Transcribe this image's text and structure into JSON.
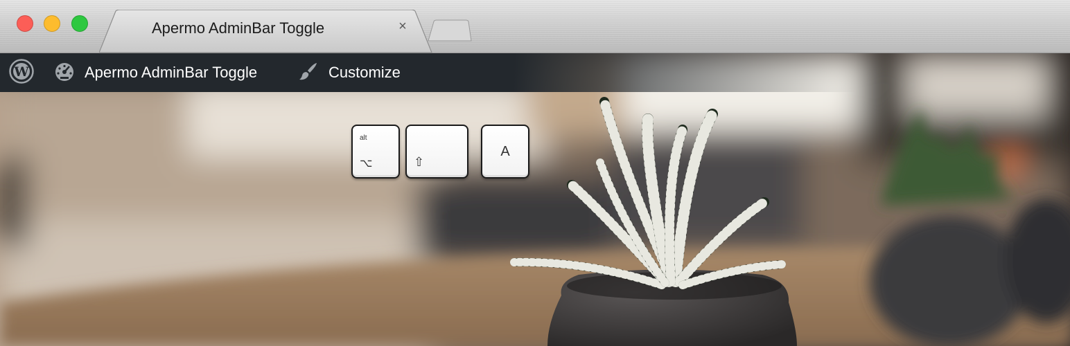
{
  "browser": {
    "active_tab": {
      "title": "Apermo AdminBar Toggle",
      "close_glyph": "×"
    },
    "window_controls": [
      "close",
      "minimize",
      "maximize"
    ],
    "new_tab_icon": "new-tab-icon"
  },
  "admin_bar": {
    "wordpress_icon": "wordpress-logo-icon",
    "site_icon": "dashboard-gauge-icon",
    "site_name": "Apermo AdminBar Toggle",
    "customize_icon": "paintbrush-icon",
    "customize_label": "Customize"
  },
  "shortcut_keys": {
    "alt": {
      "top_label": "alt",
      "symbol": "⌥"
    },
    "shift": {
      "symbol": "⇧"
    },
    "a": {
      "label": "A"
    }
  },
  "colors": {
    "admin_bar_bg": "#23282d",
    "admin_bar_text": "#ffffff",
    "traffic_close": "#fc5e57",
    "traffic_minimize": "#fdbc2e",
    "traffic_maximize": "#2ec840"
  }
}
